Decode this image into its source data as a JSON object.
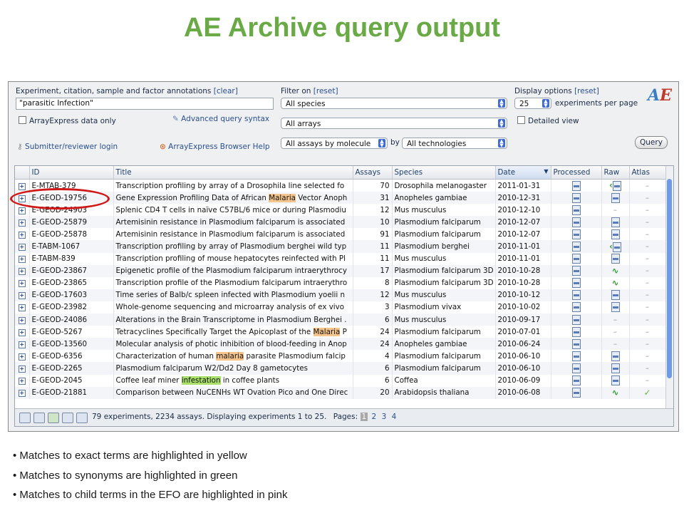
{
  "title": "AE Archive query output",
  "query": {
    "annotations_label": "Experiment, citation, sample and factor annotations",
    "clear_link": "[clear]",
    "search_value": "\"parasitic Infection\"",
    "arrayexpress_only_label": "ArrayExpress data only",
    "advanced_syntax_link": "Advanced query syntax",
    "submitter_login_link": "Submitter/reviewer login",
    "browser_help_link": "ArrayExpress Browser Help",
    "filter_label": "Filter on",
    "reset_link": "[reset]",
    "species_select": "All species",
    "arrays_select": "All arrays",
    "assays_select": "All assays by molecule",
    "by_label": "by",
    "tech_select": "All technologies",
    "display_label": "Display options",
    "per_page_value": "25",
    "per_page_label": "experiments per page",
    "detailed_view_label": "Detailed view",
    "query_button": "Query",
    "logo_a": "A",
    "logo_e": "E"
  },
  "table": {
    "headers": [
      "ID",
      "Title",
      "Assays",
      "Species",
      "Date",
      "Processed",
      "Raw",
      "Atlas"
    ],
    "rows": [
      {
        "id": "E-MTAB-379",
        "title": [
          "Transcription profiling by array of a Drosophila line selected fo"
        ],
        "assays": "70",
        "species": "Drosophila melanogaster",
        "date": "2011-01-31",
        "raw": "wave-doc",
        "atlas": "-"
      },
      {
        "id": "E-GEOD-19756",
        "title": [
          "Gene Expression Profiling Data of African ",
          {
            "hl": "y",
            "t": "Malaria"
          },
          " Vector Anoph"
        ],
        "assays": "31",
        "species": "Anopheles gambiae",
        "date": "2010-12-31",
        "raw": "doc",
        "atlas": "-"
      },
      {
        "id": "E-GEOD-24903",
        "title": [
          "Splenic CD4 T cells in naïve C57BL/6 mice or during Plasmodiu"
        ],
        "assays": "12",
        "species": "Mus musculus",
        "date": "2010-12-10",
        "raw": "-",
        "atlas": "-"
      },
      {
        "id": "E-GEOD-25879",
        "title": [
          "Artemisinin resistance in Plasmodium falciparum is associated"
        ],
        "assays": "10",
        "species": "Plasmodium falciparum",
        "date": "2010-12-07",
        "raw": "doc",
        "atlas": "-"
      },
      {
        "id": "E-GEOD-25878",
        "title": [
          "Artemisinin resistance in Plasmodium falciparum is associated"
        ],
        "assays": "91",
        "species": "Plasmodium falciparum",
        "date": "2010-12-07",
        "raw": "doc",
        "atlas": "-"
      },
      {
        "id": "E-TABM-1067",
        "title": [
          "Transcription profiling by array of Plasmodium berghei wild typ"
        ],
        "assays": "11",
        "species": "Plasmodium berghei",
        "date": "2010-11-01",
        "raw": "wave-doc",
        "atlas": "-"
      },
      {
        "id": "E-TABM-839",
        "title": [
          "Transcription profiling of mouse hepatocytes reinfected with Pl"
        ],
        "assays": "11",
        "species": "Mus musculus",
        "date": "2010-11-01",
        "raw": "doc",
        "atlas": "-"
      },
      {
        "id": "E-GEOD-23867",
        "title": [
          "Epigenetic profile of the Plasmodium falciparum intraerythrocy"
        ],
        "assays": "17",
        "species": "Plasmodium falciparum 3D",
        "date": "2010-10-28",
        "raw": "wave",
        "atlas": "-"
      },
      {
        "id": "E-GEOD-23865",
        "title": [
          "Transcription profile of the Plasmodium falciparum intraerythro"
        ],
        "assays": "8",
        "species": "Plasmodium falciparum 3D",
        "date": "2010-10-28",
        "raw": "wave",
        "atlas": "-"
      },
      {
        "id": "E-GEOD-17603",
        "title": [
          "Time series of Balb/c spleen infected with Plasmodium yoelii n"
        ],
        "assays": "12",
        "species": "Mus musculus",
        "date": "2010-10-12",
        "raw": "doc",
        "atlas": "-"
      },
      {
        "id": "E-GEOD-23982",
        "title": [
          "Whole-genome sequencing and microarray analysis of ex vivo"
        ],
        "assays": "3",
        "species": "Plasmodium vivax",
        "date": "2010-10-02",
        "raw": "doc",
        "atlas": "-"
      },
      {
        "id": "E-GEOD-24086",
        "title": [
          "Alterations in the Brain Transcriptome in Plasmodium Berghei ."
        ],
        "assays": "6",
        "species": "Mus musculus",
        "date": "2010-09-17",
        "raw": "-",
        "atlas": "-"
      },
      {
        "id": "E-GEOD-5267",
        "title": [
          "Tetracyclines Specifically Target the Apicoplast of the ",
          {
            "hl": "y",
            "t": "Malaria"
          },
          " P"
        ],
        "assays": "24",
        "species": "Plasmodium falciparum",
        "date": "2010-07-01",
        "raw": "-",
        "atlas": "-"
      },
      {
        "id": "E-GEOD-13560",
        "title": [
          "Molecular analysis of photic inhibition of blood-feeding in Anop"
        ],
        "assays": "24",
        "species": "Anopheles gambiae",
        "date": "2010-06-24",
        "raw": "-",
        "atlas": "-"
      },
      {
        "id": "E-GEOD-6356",
        "title": [
          "Characterization of human ",
          {
            "hl": "y",
            "t": "malaria"
          },
          " parasite Plasmodium falcip"
        ],
        "assays": "4",
        "species": "Plasmodium falciparum",
        "date": "2010-06-10",
        "raw": "doc",
        "atlas": "-"
      },
      {
        "id": "E-GEOD-2265",
        "title": [
          "Plasmodium falciparum W2/Dd2 Day 8 gametocytes"
        ],
        "assays": "6",
        "species": "Plasmodium falciparum",
        "date": "2010-06-10",
        "raw": "doc",
        "atlas": "-"
      },
      {
        "id": "E-GEOD-2045",
        "title": [
          "Coffee leaf miner ",
          {
            "hl": "g",
            "t": "infestation"
          },
          " in coffee plants"
        ],
        "assays": "6",
        "species": "Coffea",
        "date": "2010-06-09",
        "raw": "doc",
        "atlas": "-"
      },
      {
        "id": "E-GEOD-21881",
        "title": [
          "Comparison between NuCENHs WT Ovation Pico and One Direc"
        ],
        "assays": "20",
        "species": "Arabidopsis thaliana",
        "date": "2010-06-08",
        "raw": "wave",
        "atlas": "check"
      }
    ]
  },
  "pager": {
    "summary": "79 experiments, 2234 assays. Displaying experiments 1 to 25.",
    "pages_label": "Pages:",
    "pages": [
      "1",
      "2",
      "3",
      "4"
    ],
    "current_page": "1"
  },
  "bullets": [
    "Matches to exact terms are highlighted in yellow",
    "Matches to synonyms are highlighted in green",
    "Matches to child terms in the EFO are highlighted in pink"
  ]
}
